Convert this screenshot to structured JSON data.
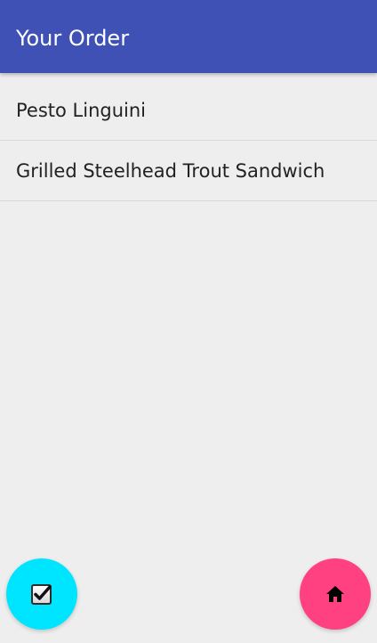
{
  "app_bar": {
    "title": "Your Order"
  },
  "order": {
    "items": [
      {
        "name": "Pesto Linguini"
      },
      {
        "name": "Grilled Steelhead Trout Sandwich"
      }
    ]
  },
  "actions": {
    "confirm_icon": "checkbox-icon",
    "home_icon": "home-icon"
  },
  "colors": {
    "app_bar": "#3F51B5",
    "background": "#EEEEEE",
    "confirm_fab": "#00E5FF",
    "home_fab": "#FF4081"
  }
}
